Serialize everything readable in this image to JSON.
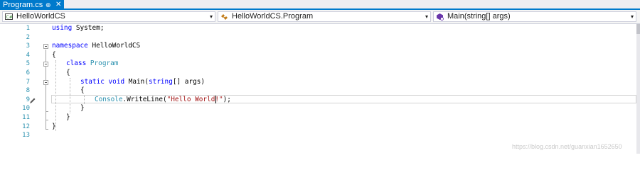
{
  "tab": {
    "title": "Program.cs",
    "pin_glyph": "⊕",
    "close_glyph": "✕"
  },
  "navbar": {
    "project_combo": {
      "label": "HelloWorldCS",
      "icon": "csharp-project-icon"
    },
    "type_combo": {
      "label": "HelloWorldCS.Program",
      "icon": "class-icon"
    },
    "member_combo": {
      "label": "Main(string[] args)",
      "icon": "method-icon"
    },
    "dropdown_glyph": "▾"
  },
  "editor": {
    "line_numbers": [
      "1",
      "2",
      "3",
      "4",
      "5",
      "6",
      "7",
      "8",
      "9",
      "10",
      "11",
      "12",
      "13"
    ],
    "code": {
      "l1_kw": "using",
      "l1_rest": " System;",
      "l3_kw": "namespace",
      "l3_rest": " HelloWorldCS",
      "l4": "{",
      "l5_kw": "class",
      "l5_type": "Program",
      "l6": "{",
      "l7_kw1": "static",
      "l7_kw2": "void",
      "l7_name": " Main(",
      "l7_kw3": "string",
      "l7_rest": "[] args)",
      "l8": "{",
      "l9_type": "Console",
      "l9_mid": ".WriteLine(",
      "l9_str": "\"Hello World!\"",
      "l9_end": ");",
      "l10": "}",
      "l11": "}",
      "l12": "}"
    },
    "current_line": 9
  },
  "watermark": "https://blog.csdn.net/guanxian1652650",
  "colors": {
    "accent": "#007acc",
    "keyword": "#0000ff",
    "type": "#2b91af",
    "string": "#a31515"
  }
}
